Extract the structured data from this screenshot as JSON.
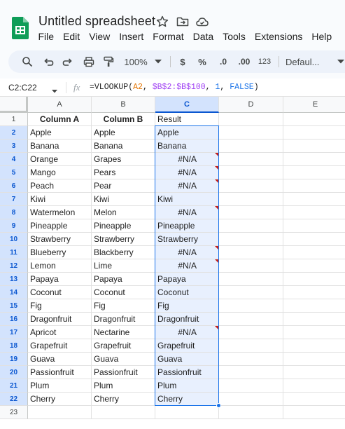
{
  "app": {
    "title": "Untitled spreadsheet",
    "menus": [
      "File",
      "Edit",
      "View",
      "Insert",
      "Format",
      "Data",
      "Tools",
      "Extensions",
      "Help"
    ]
  },
  "toolbar": {
    "zoom": "100%",
    "currency": "$",
    "percent": "%",
    "decrease_decimal": ".0",
    "increase_decimal": ".00",
    "number_format": "123",
    "font": "Defaul..."
  },
  "formula_bar": {
    "name_box": "C2:C22",
    "fx": "fx",
    "formula_prefix": "=VLOOKUP(",
    "formula_a2": "A2",
    "formula_sep1": ", ",
    "formula_range": "$B$2:$B$100",
    "formula_sep2": ", ",
    "formula_index": "1",
    "formula_sep3": ", ",
    "formula_bool": "FALSE",
    "formula_suffix": ")"
  },
  "grid": {
    "columns": [
      "A",
      "B",
      "C",
      "D",
      "E"
    ],
    "selected_column": "C",
    "headers": [
      "Column A",
      "Column B",
      "Result"
    ],
    "rows": [
      [
        "Apple",
        "Apple",
        "Apple"
      ],
      [
        "Banana",
        "Banana",
        "Banana"
      ],
      [
        "Orange",
        "Grapes",
        "#N/A"
      ],
      [
        "Mango",
        "Pears",
        "#N/A"
      ],
      [
        "Peach",
        "Pear",
        "#N/A"
      ],
      [
        "Kiwi",
        "Kiwi",
        "Kiwi"
      ],
      [
        "Watermelon",
        "Melon",
        "#N/A"
      ],
      [
        "Pineapple",
        "Pineapple",
        "Pineapple"
      ],
      [
        "Strawberry",
        "Strawberry",
        "Strawberry"
      ],
      [
        "Blueberry",
        "Blackberry",
        "#N/A"
      ],
      [
        "Lemon",
        "Lime",
        "#N/A"
      ],
      [
        "Papaya",
        "Papaya",
        "Papaya"
      ],
      [
        "Coconut",
        "Coconut",
        "Coconut"
      ],
      [
        "Fig",
        "Fig",
        "Fig"
      ],
      [
        "Dragonfruit",
        "Dragonfruit",
        "Dragonfruit"
      ],
      [
        "Apricot",
        "Nectarine",
        "#N/A"
      ],
      [
        "Grapefruit",
        "Grapefruit",
        "Grapefruit"
      ],
      [
        "Guava",
        "Guava",
        "Guava"
      ],
      [
        "Passionfruit",
        "Passionfruit",
        "Passionfruit"
      ],
      [
        "Plum",
        "Plum",
        "Plum"
      ],
      [
        "Cherry",
        "Cherry",
        "Cherry"
      ]
    ],
    "row_numbers": [
      "1",
      "2",
      "3",
      "4",
      "5",
      "6",
      "7",
      "8",
      "9",
      "10",
      "11",
      "12",
      "13",
      "14",
      "15",
      "16",
      "17",
      "18",
      "19",
      "20",
      "21",
      "22",
      "23"
    ]
  },
  "colors": {
    "accent": "#1a73e8",
    "selection_fill": "#e8f0fe",
    "error_marker": "#c5221f",
    "logo_green": "#0f9d58"
  }
}
